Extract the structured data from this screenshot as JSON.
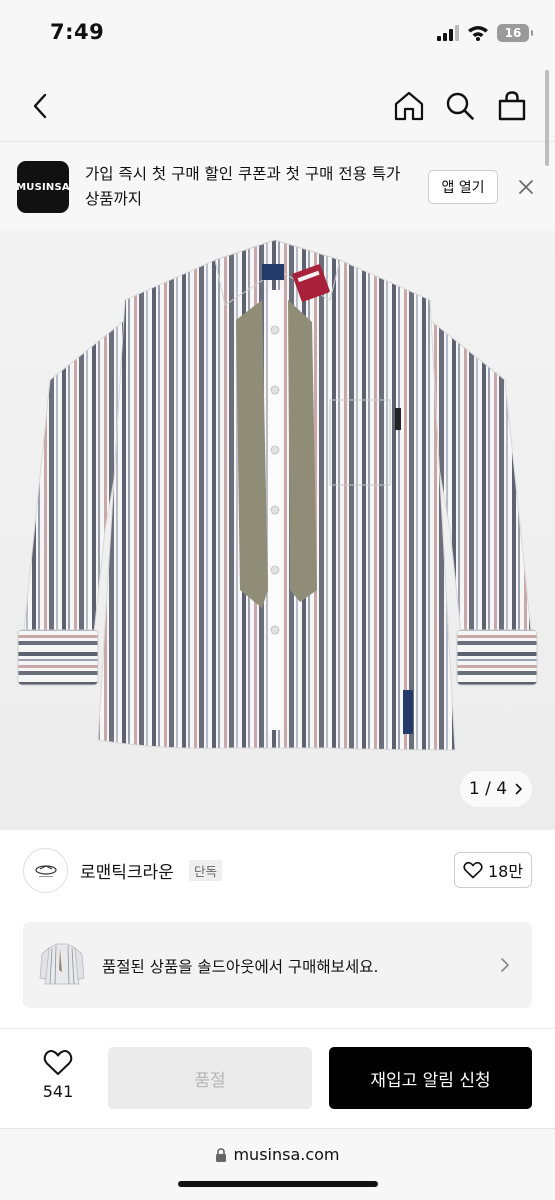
{
  "status_bar": {
    "time": "7:49",
    "battery": "16"
  },
  "nav": {
    "back_icon": "chevron-left-icon",
    "home_icon": "home-icon",
    "search_icon": "search-icon",
    "bag_icon": "shopping-bag-icon"
  },
  "app_banner": {
    "logo_text": "MUSINSA",
    "message": "가입 즉시 첫 구매 할인 쿠폰과 첫 구매 전용 특가 상품까지",
    "open_app_label": "앱 열기",
    "close_icon": "close-icon"
  },
  "product_image": {
    "counter": "1 / 4"
  },
  "brand": {
    "name": "로맨틱크라운",
    "badge": "단독",
    "like_count": "18만"
  },
  "soldout_banner": {
    "text": "품절된 상품을 솔드아웃에서 구매해보세요."
  },
  "bottom_bar": {
    "wish_count": "541",
    "soldout_label": "품절",
    "restock_label": "재입고 알림 신청"
  },
  "browser": {
    "url": "musinsa.com"
  },
  "colors": {
    "primary": "#000000",
    "disabled_bg": "#ebebeb",
    "disabled_text": "#b5b5b5",
    "toolbar_bg": "#f7f7f7"
  }
}
